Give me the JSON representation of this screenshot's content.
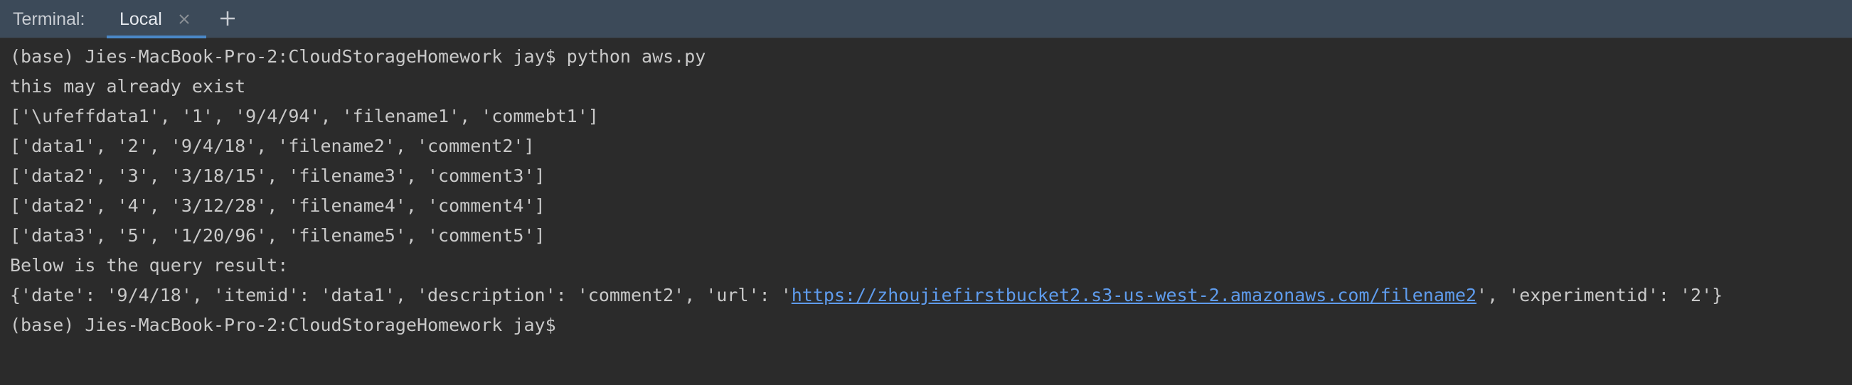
{
  "toolbar": {
    "title": "Terminal:",
    "tabs": [
      {
        "label": "Local"
      }
    ]
  },
  "icons": {
    "close": "close-icon",
    "add": "plus-icon"
  },
  "colors": {
    "tabbar_bg": "#3c4a59",
    "terminal_bg": "#2b2b2b",
    "terminal_text": "#c9c9c9",
    "tab_underline": "#4a88c7",
    "link": "#5f9ced"
  },
  "terminal": {
    "lines": [
      "(base) Jies-MacBook-Pro-2:CloudStorageHomework jay$ python aws.py",
      "this may already exist",
      "['\\ufeffdata1', '1', '9/4/94', 'filename1', 'commebt1']",
      "['data1', '2', '9/4/18', 'filename2', 'comment2']",
      "['data2', '3', '3/18/15', 'filename3', 'comment3']",
      "['data2', '4', '3/12/28', 'filename4', 'comment4']",
      "['data3', '5', '1/20/96', 'filename5', 'comment5']",
      "Below is the query result:"
    ],
    "query_line": {
      "prefix": "{'date': '9/4/18', 'itemid': 'data1', 'description': 'comment2', 'url': '",
      "url": "https://zhoujiefirstbucket2.s3-us-west-2.amazonaws.com/filename2",
      "suffix": "', 'experimentid': '2'}"
    },
    "prompt": "(base) Jies-MacBook-Pro-2:CloudStorageHomework jay$"
  }
}
